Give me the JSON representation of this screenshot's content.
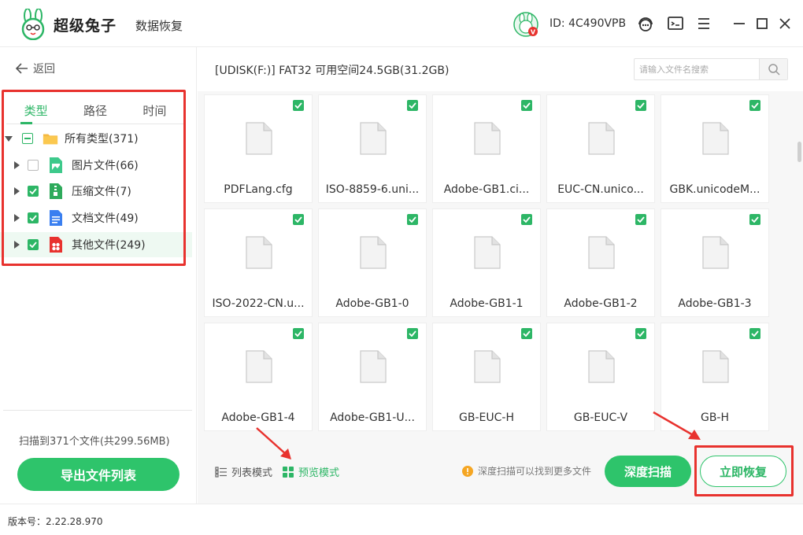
{
  "app": {
    "brand_name": "超级兔子",
    "brand_sub": "数据恢复",
    "user_id": "ID: 4C490VPB",
    "version_label": "版本号：2.22.28.970"
  },
  "sidebar": {
    "back_label": "返回",
    "tabs": [
      "类型",
      "路径",
      "时间"
    ],
    "active_tab": "类型",
    "tree": [
      {
        "label": "所有类型(371)",
        "state": "partial",
        "icon": "folder-icon"
      },
      {
        "label": "图片文件(66)",
        "state": "unchecked",
        "icon": "image-file-icon"
      },
      {
        "label": "压缩文件(7)",
        "state": "checked",
        "icon": "archive-file-icon"
      },
      {
        "label": "文档文件(49)",
        "state": "checked",
        "icon": "document-file-icon"
      },
      {
        "label": "其他文件(249)",
        "state": "checked",
        "icon": "other-file-icon"
      }
    ],
    "scan_summary": "扫描到371个文件(共299.56MB)",
    "export_label": "导出文件列表"
  },
  "main": {
    "path": "[UDISK(F:)] FAT32 可用空间24.5GB(31.2GB)",
    "search_placeholder": "请输入文件名搜索",
    "files": [
      {
        "name": "PDFLang.cfg",
        "checked": true
      },
      {
        "name": "ISO-8859-6.uni...",
        "checked": true
      },
      {
        "name": "Adobe-GB1.ci...",
        "checked": true
      },
      {
        "name": "EUC-CN.unico...",
        "checked": true
      },
      {
        "name": "GBK.unicodeM...",
        "checked": true
      },
      {
        "name": "ISO-2022-CN.u...",
        "checked": true
      },
      {
        "name": "Adobe-GB1-0",
        "checked": true
      },
      {
        "name": "Adobe-GB1-1",
        "checked": true
      },
      {
        "name": "Adobe-GB1-2",
        "checked": true
      },
      {
        "name": "Adobe-GB1-3",
        "checked": true
      },
      {
        "name": "Adobe-GB1-4",
        "checked": true
      },
      {
        "name": "Adobe-GB1-U...",
        "checked": true
      },
      {
        "name": "GB-EUC-H",
        "checked": true
      },
      {
        "name": "GB-EUC-V",
        "checked": true
      },
      {
        "name": "GB-H",
        "checked": true
      }
    ]
  },
  "bottom": {
    "list_mode_label": "列表模式",
    "preview_mode_label": "预览模式",
    "hint": "深度扫描可以找到更多文件",
    "deep_scan_label": "深度扫描",
    "recover_label": "立即恢复"
  },
  "colors": {
    "accent": "#2ec46b",
    "annotation": "#e8322e"
  }
}
